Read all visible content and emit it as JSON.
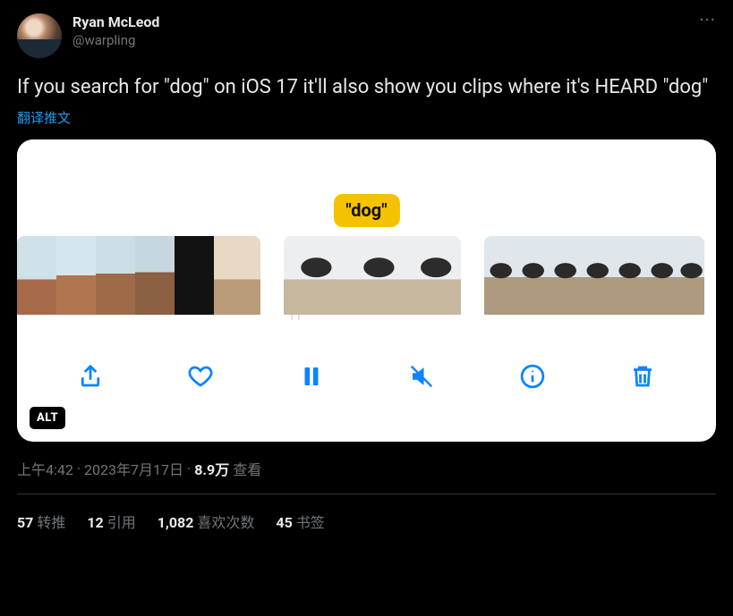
{
  "author": {
    "display_name": "Ryan McLeod",
    "handle": "@warpling"
  },
  "more_glyph": "···",
  "tweet_text": "If you search for \"dog\" on iOS 17 it'll also show you clips where it's HEARD \"dog\"",
  "translate_label": "翻译推文",
  "media": {
    "caption_pill": "\"dog\"",
    "alt_badge": "ALT",
    "toolbar": {
      "share": "share-icon",
      "like": "heart-icon",
      "pause": "pause-icon",
      "mute": "mute-icon",
      "info": "info-icon",
      "trash": "trash-icon"
    }
  },
  "meta": {
    "time": "上午4:42",
    "dot1": " · ",
    "date": "2023年7月17日",
    "dot2": " · ",
    "view_count": "8.9万",
    "view_label": " 查看"
  },
  "stats": {
    "retweets_num": "57",
    "retweets_label": "转推",
    "quotes_num": "12",
    "quotes_label": "引用",
    "likes_num": "1,082",
    "likes_label": "喜欢次数",
    "bookmarks_num": "45",
    "bookmarks_label": "书签"
  }
}
